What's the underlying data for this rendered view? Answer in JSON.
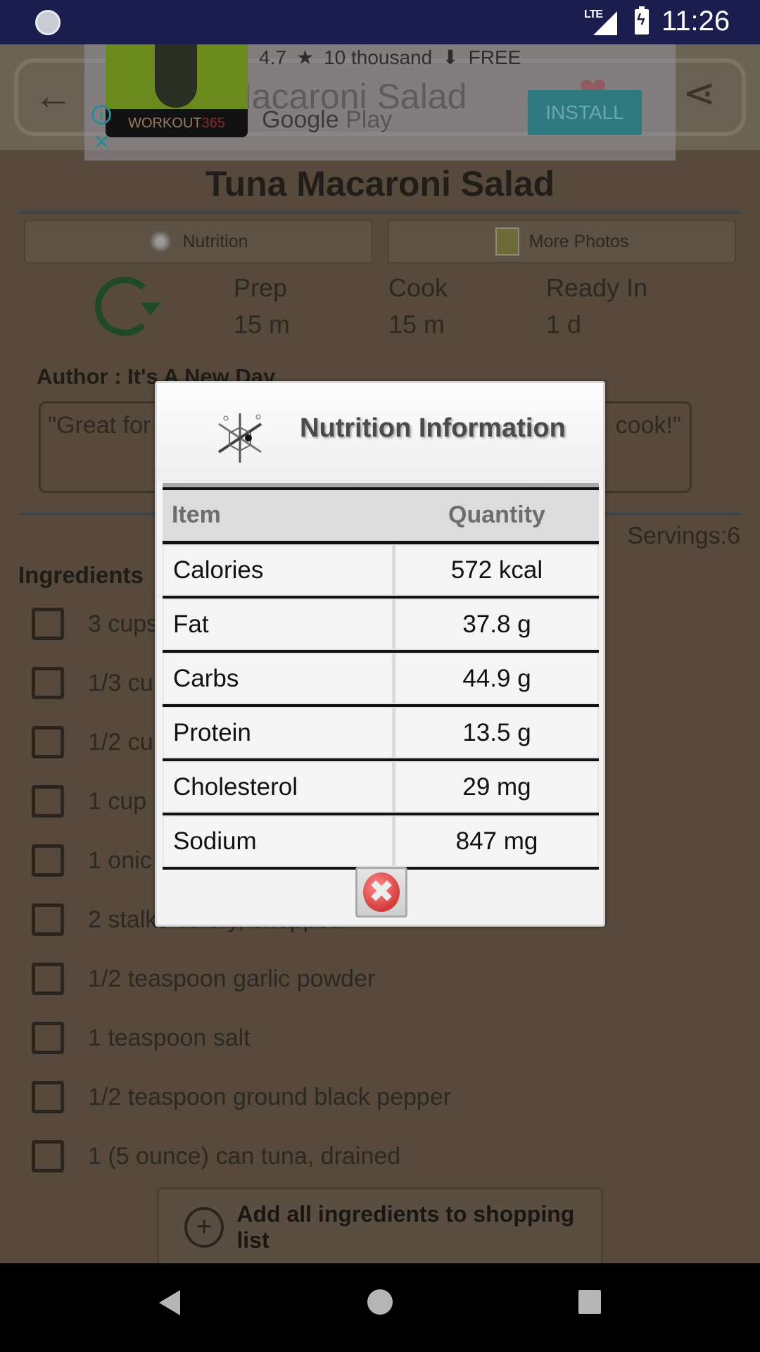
{
  "status_bar": {
    "network": "LTE",
    "time": "11:26"
  },
  "action_bar": {
    "title": "Tuna Macaroni Salad",
    "back_icon": "arrow-left-icon",
    "share_icon": "share-icon",
    "favorite_icon": "heart-icon"
  },
  "ad": {
    "app_brand": "WORKOUT",
    "app_brand_suffix": "365",
    "rating": "4.7",
    "rating_icon": "★",
    "downloads": "10 thousand",
    "download_icon": "⬇",
    "price": "FREE",
    "store": "Google",
    "store_suffix": "Play",
    "install_label": "INSTALL",
    "info_label": "i",
    "close_label": "✕"
  },
  "recipe": {
    "title": "Tuna Macaroni Salad",
    "nutrition_tab": "Nutrition",
    "photos_tab": "More Photos",
    "times": [
      {
        "label": "Prep",
        "value": "15 m"
      },
      {
        "label": "Cook",
        "value": "15 m"
      },
      {
        "label": "Ready In",
        "value": "1 d"
      }
    ],
    "author": "Author : It's A New Day",
    "quote_start": "\"Great for",
    "quote_end": "cook!\"",
    "servings": "Servings:6",
    "ingredients_heading": "Ingredients",
    "ingredients": [
      "3 cups",
      "1/3 cu",
      "1/2 cu",
      "1 cup",
      "1 onic",
      "2 stalks celery, chopped",
      "1/2 teaspoon garlic powder",
      "1 teaspoon salt",
      "1/2 teaspoon ground black pepper",
      "1 (5 ounce) can tuna, drained"
    ],
    "add_all_label": "Add all ingredients to shopping list",
    "add_all_icon": "+"
  },
  "dialog": {
    "title": "Nutrition Information",
    "columns": [
      "Item",
      "Quantity"
    ],
    "rows": [
      {
        "item": "Calories",
        "quantity": "572 kcal"
      },
      {
        "item": "Fat",
        "quantity": "37.8 g"
      },
      {
        "item": "Carbs",
        "quantity": "44.9 g"
      },
      {
        "item": "Protein",
        "quantity": "13.5 g"
      },
      {
        "item": "Cholesterol",
        "quantity": "29 mg"
      },
      {
        "item": "Sodium",
        "quantity": "847 mg"
      }
    ],
    "close_label": "✖"
  }
}
